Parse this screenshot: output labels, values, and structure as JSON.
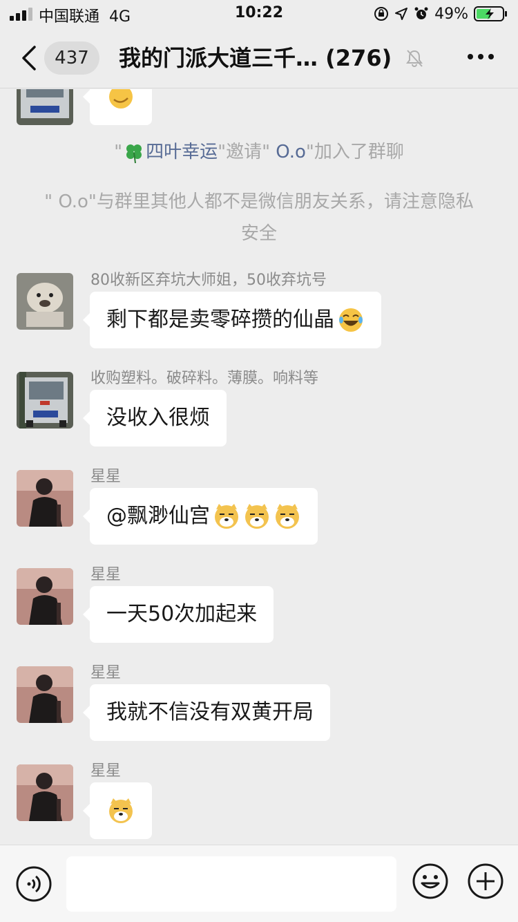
{
  "status_bar": {
    "carrier": "中国联通",
    "network": "4G",
    "time": "10:22",
    "battery": "49%"
  },
  "nav": {
    "unread_count": "437",
    "title": "我的门派大道三千…",
    "member_count": "(276)"
  },
  "system_messages": {
    "invite": {
      "q1": "\"",
      "inviter": "四叶幸运",
      "mid": "\"邀请\"",
      "invitee": "O.o",
      "tail": "\"加入了群聊"
    },
    "privacy_notice": "\" O.o\"与群里其他人都不是微信朋友关系，请注意隐私安全"
  },
  "messages": [
    {
      "sender": "80收新区弃坑大师姐，50收弃坑号",
      "text": "剩下都是卖零碎攒的仙晶",
      "emoji": "laughing-tears-emoji"
    },
    {
      "sender": "收购塑料。破碎料。薄膜。响料等",
      "text": "没收入很烦"
    },
    {
      "sender": "星星",
      "text": "@飘渺仙宫 ",
      "emoji": "doge-emoji x3"
    },
    {
      "sender": "星星",
      "text": "一天50次加起来"
    },
    {
      "sender": "星星",
      "text": "我就不信没有双黄开局"
    },
    {
      "sender": "星星",
      "text": "",
      "emoji": "doge-emoji"
    }
  ],
  "input": {
    "placeholder": ""
  },
  "colors": {
    "background": "#ededed",
    "bubble": "#ffffff",
    "link": "#576b95",
    "system_text": "#a8a8a8",
    "battery_fill": "#4cd964"
  }
}
